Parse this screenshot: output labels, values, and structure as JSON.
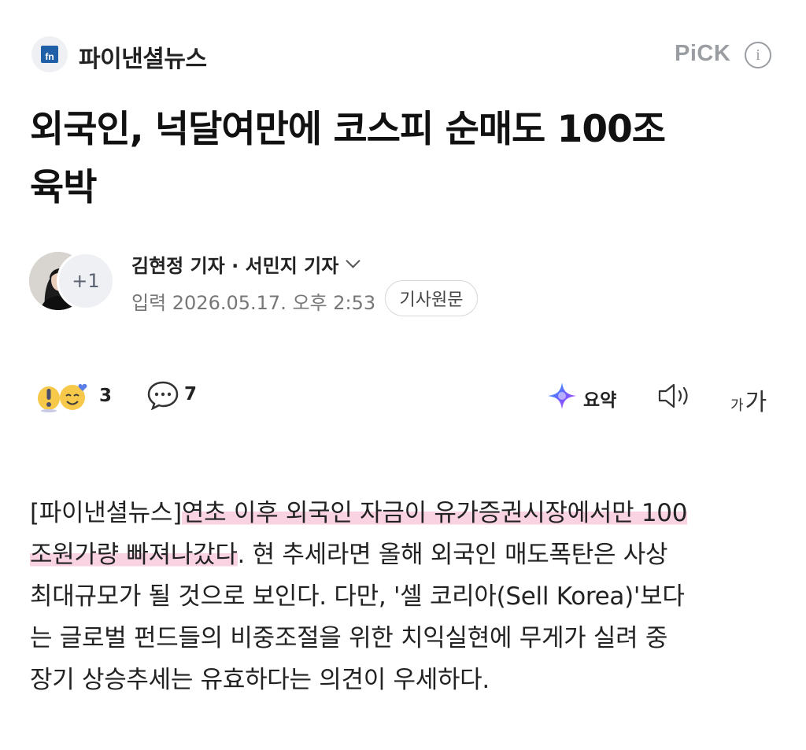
{
  "header": {
    "press_logo_text": "fn",
    "press_name": "파이낸셜뉴스",
    "pick_label": "PiCK",
    "info_icon": "info-icon"
  },
  "article": {
    "headline_line1": "외국인, 넉달여만에 코스피 순매도 100조",
    "headline_line2": "육박",
    "reporters": "김현정 기자 · 서민지 기자",
    "extra_reporters": "+1",
    "date": "입력 2026.05.17. 오후 2:53",
    "original_button": "기사원문"
  },
  "actions": {
    "reaction_count": "3",
    "comment_count": "7",
    "summary_label": "요약",
    "font_small": "가",
    "font_large": "가"
  },
  "body": {
    "prefix": "[파이낸셜뉴스]",
    "highlight_1": "연초 이후 외국인 자금이 유가증권시장에서만 100",
    "highlight_2": "조원가량 빠져나갔다",
    "rest_1": ". 현 추세라면 올해 외국인 매도폭탄은 사상",
    "rest_2": "최대규모가 될 것으로 보인다. 다만, '셀 코리아(Sell Korea)'보다",
    "rest_3": "는 글로벌 펀드들의 비중조절을 위한 치익실현에 무게가 실려 중",
    "rest_4": "장기 상승추세는 유효하다는 의견이 우세하다."
  },
  "colors": {
    "highlight": "#f9d3e2",
    "logo_blue": "#1f5fa8",
    "muted_gray": "#9a9ea3"
  }
}
